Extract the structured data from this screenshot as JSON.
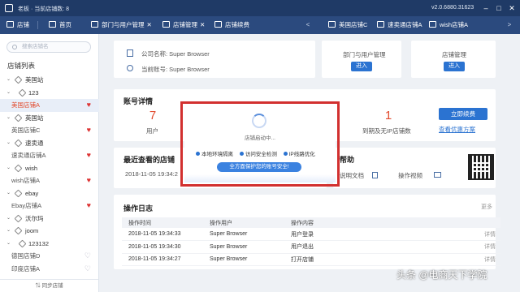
{
  "titlebar": {
    "user": "老板 · 当前店铺数: 8",
    "version": "v2.0.6880.31623"
  },
  "nav": {
    "items": [
      "店铺",
      "首页",
      "部门与用户管理",
      "店铺管理",
      "店铺续费"
    ],
    "shop_tabs": [
      "美国店铺C",
      "速卖通店铺A",
      "wish店铺A"
    ]
  },
  "sidebar": {
    "search_placeholder": "搜索店铺名",
    "title": "店铺列表",
    "tree": [
      {
        "level": 1,
        "text": "美国站"
      },
      {
        "level": 2,
        "text": "123"
      },
      {
        "level": 0,
        "text": "美国店铺A",
        "active": true,
        "fav": true
      },
      {
        "level": 1,
        "text": "英国站"
      },
      {
        "level": 0,
        "text": "英国店铺C",
        "fav": true
      },
      {
        "level": 1,
        "text": "速卖通"
      },
      {
        "level": 0,
        "text": "速卖通店铺A",
        "fav": true
      },
      {
        "level": 1,
        "text": "wish"
      },
      {
        "level": 0,
        "text": "wish店铺A",
        "fav": true
      },
      {
        "level": 1,
        "text": "ebay"
      },
      {
        "level": 0,
        "text": "Ebay店铺A",
        "fav": true
      },
      {
        "level": 1,
        "text": "沃尔玛"
      },
      {
        "level": 1,
        "text": "joom"
      },
      {
        "level": 2,
        "text": "123132"
      },
      {
        "level": 0,
        "text": "德国店铺D",
        "fav": false
      },
      {
        "level": 0,
        "text": "印度店铺A",
        "fav": false
      }
    ],
    "footer": "同步店铺"
  },
  "company": {
    "name_label": "公司名称: Super Browser",
    "account_label": "当前账号: Super Browser"
  },
  "dept_card": {
    "title": "部门与用户管理",
    "button": "进入"
  },
  "shop_card": {
    "title": "店铺管理",
    "button": "进入"
  },
  "account": {
    "title": "账号详情",
    "users_value": "7",
    "users_label": "用户",
    "expiring_value": "1",
    "expiring_label": "到期及无IP店铺数",
    "renew_button": "立即续费",
    "offer_link": "查看优惠方案"
  },
  "recent": {
    "title": "最近查看的店铺",
    "time": "2018-11-05 19:34:2"
  },
  "help": {
    "title": "帮助",
    "doc": "说明文档",
    "video": "操作视频"
  },
  "log": {
    "title": "操作日志",
    "more": "更多",
    "headers": [
      "操作时间",
      "操作用户",
      "操作内容",
      ""
    ],
    "rows": [
      {
        "time": "2018-11-05 19:34:33",
        "user": "Super Browser",
        "action": "用户登录",
        "detail": "详情"
      },
      {
        "time": "2018-11-05 19:34:30",
        "user": "Super Browser",
        "action": "用户退出",
        "detail": "详情"
      },
      {
        "time": "2018-11-05 19:34:27",
        "user": "Super Browser",
        "action": "打开店铺",
        "detail": "详情"
      }
    ]
  },
  "modal": {
    "status": "店铺启动中...",
    "checks": [
      "本地环境隔离",
      "访问安全检测",
      "IP线路优化"
    ],
    "banner": "全方面保护您的账号安全!"
  },
  "watermark": "头条 @电商天下学院"
}
